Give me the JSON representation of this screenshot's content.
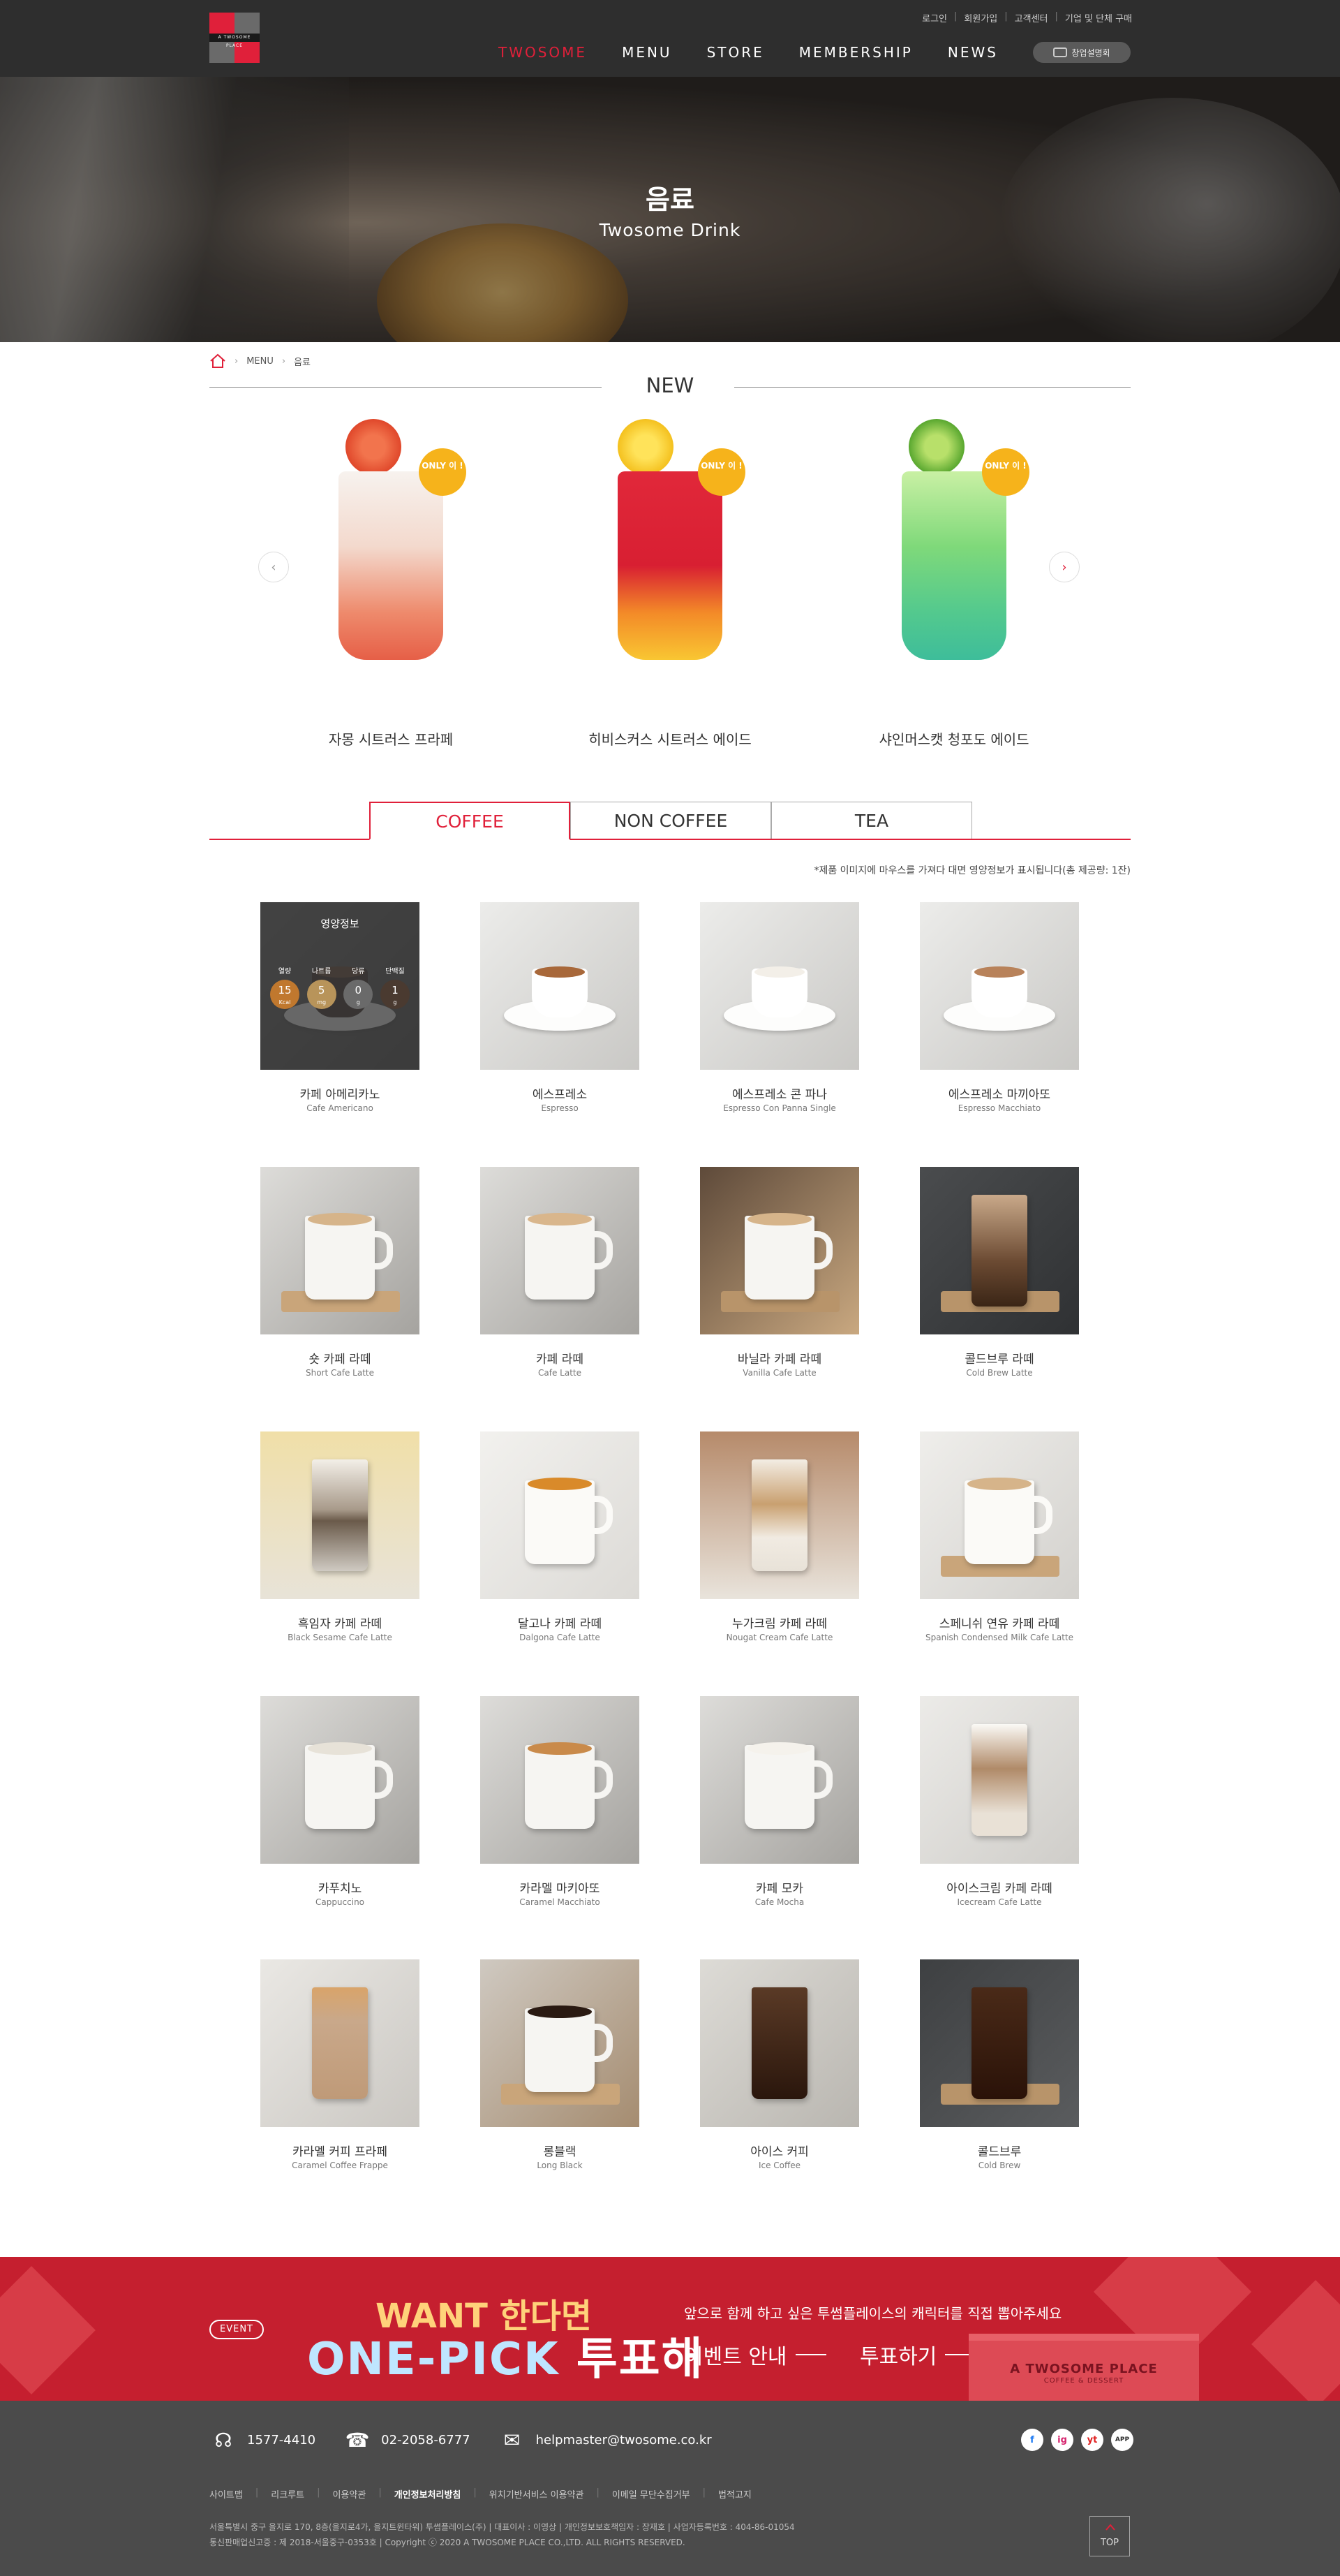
{
  "header": {
    "util": [
      "로그인",
      "회원가입",
      "고객센터",
      "기업 및 단체 구매"
    ],
    "nav": [
      "TWOSOME",
      "MENU",
      "STORE",
      "MEMBERSHIP",
      "NEWS"
    ],
    "franchise_label": "창업설명회",
    "logo_text": "A TWOSOME PLACE"
  },
  "hero": {
    "title": "음료",
    "subtitle": "Twosome Drink"
  },
  "breadcrumb": [
    "MENU",
    "음료"
  ],
  "new_section": {
    "title": "NEW",
    "items": [
      {
        "name": "자몽 시트러스 프라페",
        "badge": "ONLY 이 !"
      },
      {
        "name": "히비스커스 시트러스 에이드",
        "badge": "ONLY 이 !"
      },
      {
        "name": "샤인머스캣 청포도 에이드",
        "badge": "ONLY 이 !"
      }
    ]
  },
  "tabs": [
    "COFFEE",
    "NON COFFEE",
    "TEA"
  ],
  "notice": "*제품 이미지에 마우스를 가져다 대면 영양정보가 표시됩니다(총 제공량: 1잔)",
  "nutrition": {
    "title": "영양정보",
    "labels": [
      "열량",
      "나트륨",
      "당류",
      "단백질"
    ],
    "values": [
      "15",
      "5",
      "0",
      "1"
    ],
    "units": [
      "Kcal",
      "mg",
      "g",
      "g"
    ],
    "colors": [
      "#c0782e",
      "#b8945a",
      "#6a6a6a",
      "#4a3a30"
    ]
  },
  "products": [
    {
      "ko": "카페 아메리카노",
      "en": "Cafe Americano"
    },
    {
      "ko": "에스프레소",
      "en": "Espresso"
    },
    {
      "ko": "에스프레소 콘 파나",
      "en": "Espresso Con Panna Single"
    },
    {
      "ko": "에스프레소 마끼아또",
      "en": "Espresso Macchiato"
    },
    {
      "ko": "숏 카페 라떼",
      "en": "Short Cafe Latte"
    },
    {
      "ko": "카페 라떼",
      "en": "Cafe Latte"
    },
    {
      "ko": "바닐라 카페 라떼",
      "en": "Vanilla Cafe Latte"
    },
    {
      "ko": "콜드브루 라떼",
      "en": "Cold Brew Latte"
    },
    {
      "ko": "흑임자 카페 라떼",
      "en": "Black Sesame Cafe Latte"
    },
    {
      "ko": "달고나 카페 라떼",
      "en": "Dalgona Cafe Latte"
    },
    {
      "ko": "누가크림 카페 라떼",
      "en": "Nougat Cream Cafe Latte"
    },
    {
      "ko": "스페니쉬 연유 카페 라떼",
      "en": "Spanish Condensed Milk Cafe Latte"
    },
    {
      "ko": "카푸치노",
      "en": "Cappuccino"
    },
    {
      "ko": "카라멜 마키아또",
      "en": "Caramel Macchiato"
    },
    {
      "ko": "카페 모카",
      "en": "Cafe Mocha"
    },
    {
      "ko": "아이스크림 카페 라떼",
      "en": "Icecream Cafe Latte"
    },
    {
      "ko": "카라멜 커피 프라페",
      "en": "Caramel Coffee Frappe"
    },
    {
      "ko": "롱블랙",
      "en": "Long Black"
    },
    {
      "ko": "아이스 커피",
      "en": "Ice Coffee"
    },
    {
      "ko": "콜드브루",
      "en": "Cold Brew"
    }
  ],
  "event": {
    "tag": "EVENT",
    "line1": "WANT 한다면",
    "line2a": "ONE-PICK",
    "line2b": "투표해",
    "desc": "앞으로 함께 하고 싶은 투썸플레이스의 캐릭터를 직접 뽑아주세요",
    "link1": "이벤트 안내",
    "link2": "투표하기",
    "box_brand": "A TWOSOME PLACE",
    "box_sub": "COFFEE & DESSERT"
  },
  "footer": {
    "phone1": "1577-4410",
    "phone2": "02-2058-6777",
    "email": "helpmaster@twosome.co.kr",
    "links": [
      "사이트맵",
      "리크루트",
      "이용약관",
      "개인정보처리방침",
      "위치기반서비스 이용약관",
      "이메일 무단수집거부",
      "법적고지"
    ],
    "info1": "서울특별시 중구 을지로 170, 8층(을지로4가, 을지트윈타워) 투썸플레이스(주)   |   대표이사 : 이영상   |   개인정보보호책임자 : 장재호   |   사업자등록번호 : 404-86-01054",
    "info2": "통신판매업신고증 : 제 2018-서울중구-0353호   |   Copyright ⓒ 2020 A TWOSOME PLACE CO.,LTD. ALL RIGHTS RESERVED.",
    "sns": [
      "f",
      "ig",
      "yt",
      "APP"
    ],
    "top": "TOP"
  }
}
